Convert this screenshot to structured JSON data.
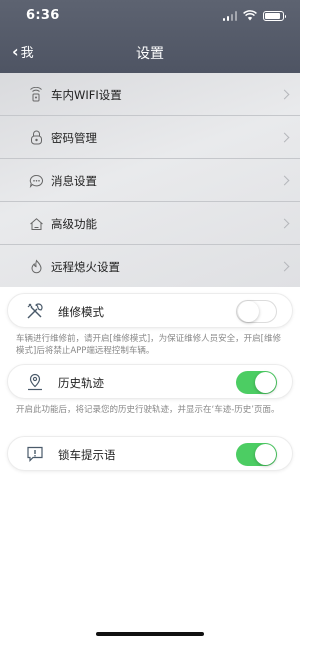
{
  "status_bar": {
    "time": "6:36"
  },
  "nav": {
    "back_label": "我",
    "title": "设置"
  },
  "menu": [
    {
      "label": "车内WIFI设置",
      "icon": "wifi-icon"
    },
    {
      "label": "密码管理",
      "icon": "lock-icon"
    },
    {
      "label": "消息设置",
      "icon": "message-icon"
    },
    {
      "label": "高级功能",
      "icon": "home-icon"
    },
    {
      "label": "远程熄火设置",
      "icon": "flame-icon"
    }
  ],
  "toggles": [
    {
      "label": "维修模式",
      "icon": "tools-icon",
      "on": false,
      "note": "车辆进行维修前，请开启[维修模式]，为保证维修人员安全，开启[维修模式]后将禁止APP端远程控制车辆。"
    },
    {
      "label": "历史轨迹",
      "icon": "location-pin-icon",
      "on": true,
      "note": "开启此功能后，将记录您的历史行驶轨迹，并显示在‘车迹-历史’页面。"
    },
    {
      "label": "锁车提示语",
      "icon": "alert-message-icon",
      "on": true,
      "note": ""
    }
  ],
  "colors": {
    "header": "#565c6b",
    "toggle_on": "#4ccd63"
  }
}
